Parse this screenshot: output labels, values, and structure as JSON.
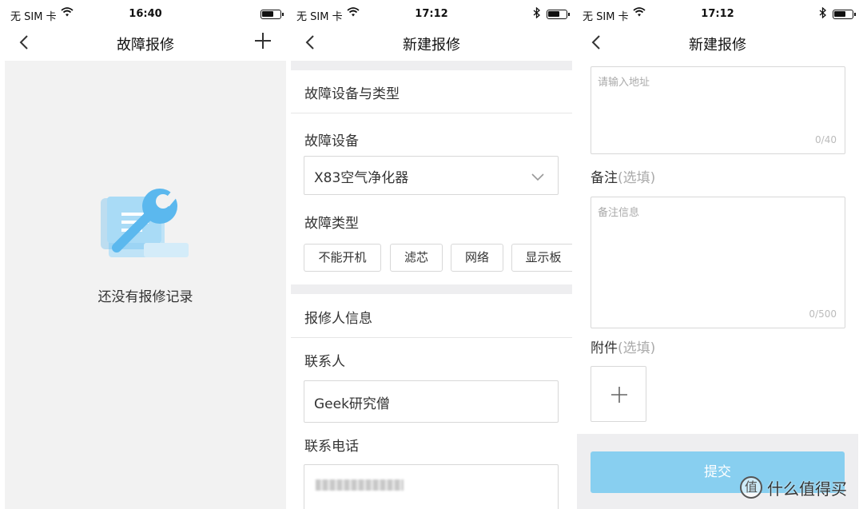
{
  "status": {
    "carrier": "无 SIM 卡",
    "s1_time": "16:40",
    "s2_time": "17:12",
    "s3_time": "17:12"
  },
  "screen1": {
    "title": "故障报修",
    "empty_text": "还没有报修记录"
  },
  "screen2": {
    "title": "新建报修",
    "section_device": "故障设备与类型",
    "device_label": "故障设备",
    "device_value": "X83空气净化器",
    "type_label": "故障类型",
    "types": [
      "不能开机",
      "滤芯",
      "网络",
      "显示板"
    ],
    "section_reporter": "报修人信息",
    "contact_label": "联系人",
    "contact_value": "Geek研究僧",
    "phone_label": "联系电话"
  },
  "screen3": {
    "title": "新建报修",
    "address_placeholder": "请输入地址",
    "address_counter": "0/40",
    "remark_label": "备注",
    "remark_optional": "(选填)",
    "remark_placeholder": "备注信息",
    "remark_counter": "0/500",
    "attach_label": "附件",
    "attach_optional": "(选填)",
    "submit_label": "提交"
  },
  "watermark": {
    "glyph": "值",
    "text": "什么值得买"
  },
  "colors": {
    "accent_light": "#88cff0",
    "icon_blue": "#5bb8ee",
    "page_gray": "#f2f2f2"
  }
}
